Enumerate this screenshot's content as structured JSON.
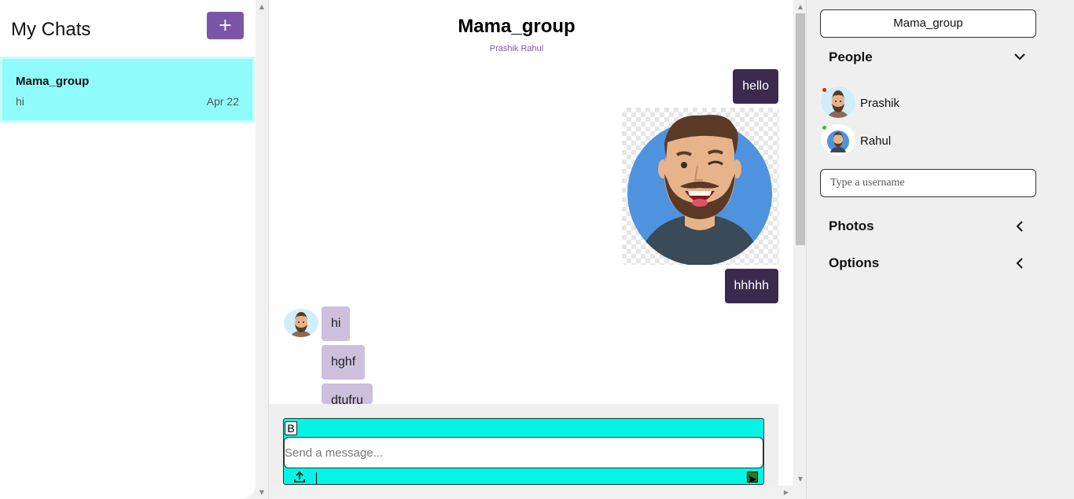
{
  "left": {
    "title": "My Chats",
    "new_chat_label": "+",
    "chats": [
      {
        "name": "Mama_group",
        "last_message": "hi",
        "date": "Apr 22"
      }
    ]
  },
  "main": {
    "title": "Mama_group",
    "members": "Prashik Rahul",
    "messages": [
      {
        "text": "hello",
        "direction": "out"
      },
      {
        "text": "",
        "direction": "out",
        "type": "image",
        "image": "winking-bearded-man-avatar"
      },
      {
        "text": "hhhhh",
        "direction": "out"
      },
      {
        "text": "hi",
        "direction": "in"
      },
      {
        "text": "hghf",
        "direction": "in"
      },
      {
        "text": "dtufru",
        "direction": "in"
      }
    ],
    "composer": {
      "bold_label": "B",
      "placeholder": "Send a message...",
      "upload_icon": "upload-icon",
      "send_icon": "send-icon"
    }
  },
  "right": {
    "group_name": "Mama_group",
    "people_label": "People",
    "members": [
      {
        "name": "Prashik",
        "status_color": "#e02020"
      },
      {
        "name": "Rahul",
        "status_color": "#2fbf2f"
      }
    ],
    "username_placeholder": "Type a username",
    "photos_label": "Photos",
    "options_label": "Options"
  },
  "colors": {
    "accent": "#7b56a6",
    "selected_chat": "#8ffcfb",
    "outgoing_bubble": "#3b2a4d",
    "incoming_bubble": "#ccc0dd",
    "composer": "#00f5e4"
  }
}
